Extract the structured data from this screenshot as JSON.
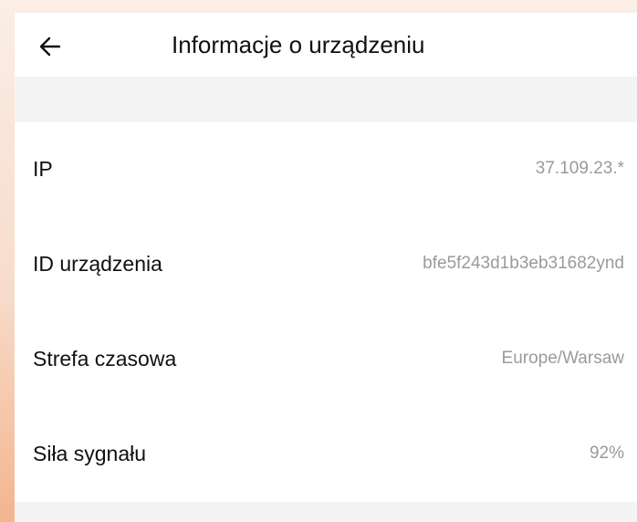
{
  "header": {
    "back_icon": "arrow-left-icon",
    "title": "Informacje o urządzeniu"
  },
  "rows": [
    {
      "label": "IP",
      "value": "37.109.23.*"
    },
    {
      "label": "ID urządzenia",
      "value": "bfe5f243d1b3eb31682ynd"
    },
    {
      "label": "Strefa czasowa",
      "value": "Europe/Warsaw"
    },
    {
      "label": "Siła sygnału",
      "value": "92%"
    }
  ],
  "colors": {
    "background": "#f4f4f4",
    "surface": "#ffffff",
    "text_primary": "#111111",
    "text_secondary": "#9a9a9a",
    "frame_accent": "#f3b58f"
  }
}
